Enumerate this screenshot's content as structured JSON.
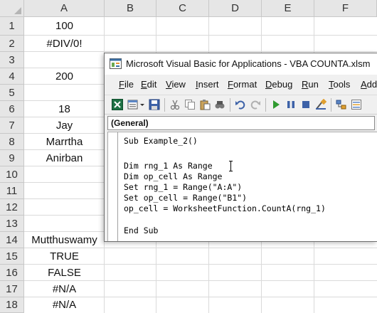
{
  "sheet": {
    "columns": [
      "A",
      "B",
      "C",
      "D",
      "E",
      "F"
    ],
    "rows": [
      {
        "num": "1",
        "a": "100"
      },
      {
        "num": "2",
        "a": "#DIV/0!"
      },
      {
        "num": "3",
        "a": ""
      },
      {
        "num": "4",
        "a": "200"
      },
      {
        "num": "5",
        "a": ""
      },
      {
        "num": "6",
        "a": "18"
      },
      {
        "num": "7",
        "a": "Jay"
      },
      {
        "num": "8",
        "a": "Marrtha"
      },
      {
        "num": "9",
        "a": "Anirban"
      },
      {
        "num": "10",
        "a": ""
      },
      {
        "num": "11",
        "a": ""
      },
      {
        "num": "12",
        "a": ""
      },
      {
        "num": "13",
        "a": ""
      },
      {
        "num": "14",
        "a": "Mutthuswamy"
      },
      {
        "num": "15",
        "a": "TRUE"
      },
      {
        "num": "16",
        "a": "FALSE"
      },
      {
        "num": "17",
        "a": "#N/A"
      },
      {
        "num": "18",
        "a": "#N/A"
      }
    ]
  },
  "vbe": {
    "title": "Microsoft Visual Basic for Applications - VBA COUNTA.xlsm",
    "menu": [
      {
        "u": "F",
        "rest": "ile"
      },
      {
        "u": "E",
        "rest": "dit"
      },
      {
        "u": "V",
        "rest": "iew"
      },
      {
        "u": "I",
        "rest": "nsert"
      },
      {
        "u": "F",
        "rest": "ormat"
      },
      {
        "u": "D",
        "rest": "ebug"
      },
      {
        "u": "R",
        "rest": "un"
      },
      {
        "u": "T",
        "rest": "ools"
      },
      {
        "u": "A",
        "rest": "dd"
      }
    ],
    "object_combo": "(General)",
    "code": [
      "Sub Example_2()",
      "",
      "Dim rng_1 As Range",
      "Dim op_cell As Range",
      "Set rng_1 = Range(\"A:A\")",
      "Set op_cell = Range(\"B1\")",
      "op_cell = WorksheetFunction.CountA(rng_1)",
      "",
      "End Sub"
    ]
  },
  "colors": {
    "header_bg": "#e6e6e6",
    "grid": "#dadada",
    "window_bg": "#f0f0f0"
  }
}
